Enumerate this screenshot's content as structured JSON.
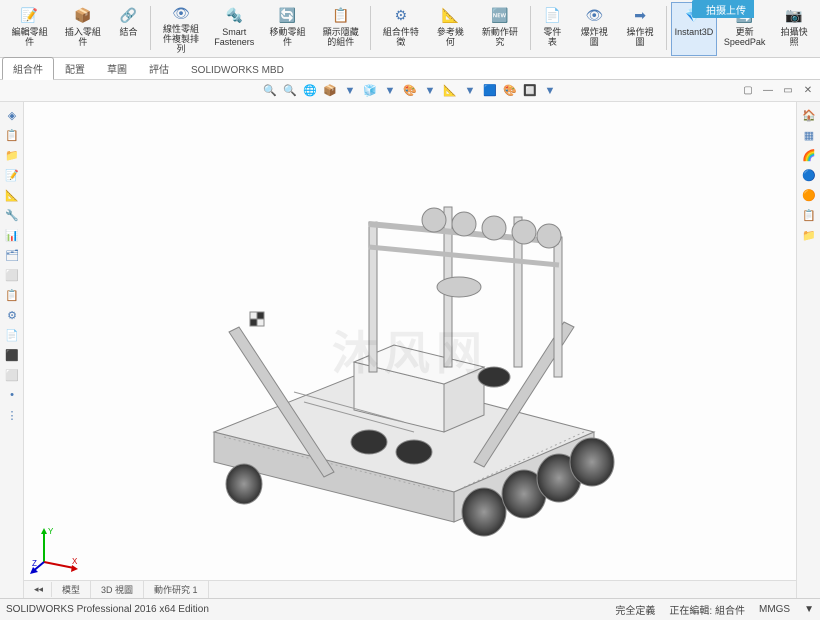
{
  "upload_btn": "拍摄上传",
  "ribbon": [
    {
      "icon": "📝",
      "label": "編輯零組件"
    },
    {
      "icon": "📦",
      "label": "插入零組件"
    },
    {
      "icon": "🔗",
      "label": "結合"
    },
    {
      "icon": "👁",
      "label": "線性零組件複製排列"
    },
    {
      "icon": "🔩",
      "label": "Smart Fasteners"
    },
    {
      "icon": "🔄",
      "label": "移動零組件"
    },
    {
      "icon": "📋",
      "label": "顯示隱藏的組件"
    },
    {
      "icon": "⚙",
      "label": "組合件特徵"
    },
    {
      "icon": "📐",
      "label": "參考幾何"
    },
    {
      "icon": "🆕",
      "label": "新動作研究"
    },
    {
      "icon": "📄",
      "label": "零件表"
    },
    {
      "icon": "👁",
      "label": "爆炸視圖"
    },
    {
      "icon": "➡",
      "label": "操作視圖"
    },
    {
      "icon": "💎",
      "label": "Instant3D",
      "active": true
    },
    {
      "icon": "🔄",
      "label": "更新 SpeedPak"
    },
    {
      "icon": "📷",
      "label": "拍攝快照"
    }
  ],
  "tabs": [
    "組合件",
    "配置",
    "草圖",
    "評估",
    "SOLIDWORKS MBD"
  ],
  "active_tab": 0,
  "qbar": [
    "🔍",
    "🔍",
    "🌐",
    "📦",
    "▼",
    "🧊",
    "▼",
    "🎨",
    "▼",
    "📐",
    "▼",
    "🟦",
    "🎨",
    "🔲",
    "▼"
  ],
  "ltools": [
    "◈",
    "📋",
    "📁",
    "📝",
    "📐",
    "🔧",
    "📊",
    "🗂",
    "⬜",
    "📋",
    "⚙",
    "📄",
    "⬛",
    "⬜",
    "•",
    "⋮"
  ],
  "rtools": [
    {
      "icon": "🏠",
      "color": "#888"
    },
    {
      "icon": "▦",
      "color": "#4a7ab5"
    },
    {
      "icon": "🌈",
      "color": "#e06"
    },
    {
      "icon": "🔵",
      "color": "#1a9"
    },
    {
      "icon": "🟠",
      "color": "#e80"
    },
    {
      "icon": "📋",
      "color": "#888"
    },
    {
      "icon": "📁",
      "color": "#888"
    }
  ],
  "bottom_tabs": [
    "模型",
    "3D 視圖",
    "動作研究 1"
  ],
  "watermark": "沐风网",
  "status": {
    "left": "SOLIDWORKS Professional 2016 x64 Edition",
    "right": [
      "完全定義",
      "正在編輯: 組合件",
      "MMGS",
      "▼"
    ]
  }
}
